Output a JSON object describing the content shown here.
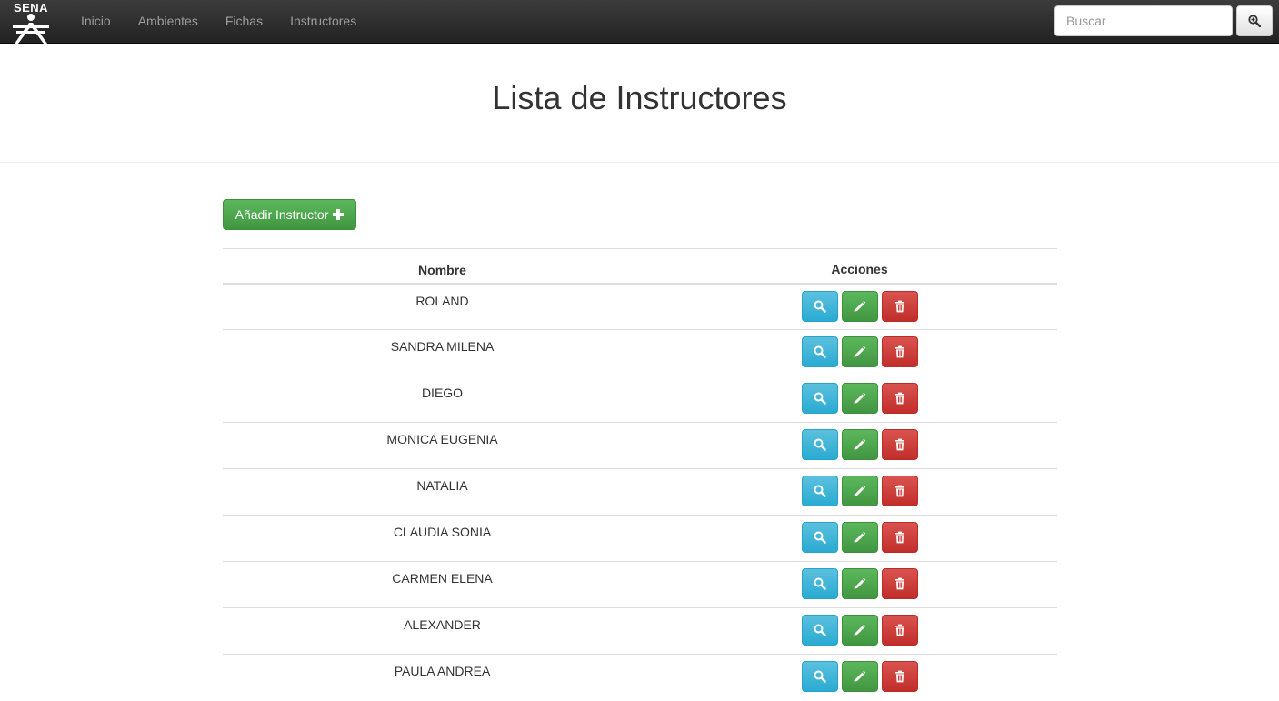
{
  "brand": {
    "logo_text": "SENA"
  },
  "nav": {
    "items": [
      {
        "label": "Inicio"
      },
      {
        "label": "Ambientes"
      },
      {
        "label": "Fichas"
      },
      {
        "label": "Instructores"
      }
    ]
  },
  "search": {
    "placeholder": "Buscar",
    "icon": "zoom-in-icon"
  },
  "page": {
    "title": "Lista de Instructores"
  },
  "toolbar": {
    "add_label": "Añadir Instructor",
    "add_icon": "plus-icon"
  },
  "table": {
    "columns": [
      "Nombre",
      "Acciones"
    ],
    "rows": [
      {
        "name": "ROLAND"
      },
      {
        "name": "SANDRA MILENA"
      },
      {
        "name": "DIEGO"
      },
      {
        "name": "MONICA EUGENIA"
      },
      {
        "name": "NATALIA"
      },
      {
        "name": "CLAUDIA SONIA"
      },
      {
        "name": "CARMEN ELENA"
      },
      {
        "name": "ALEXANDER"
      },
      {
        "name": "PAULA ANDREA"
      }
    ],
    "row_actions": [
      {
        "name": "view",
        "icon": "search-icon",
        "color": "#5bc0de"
      },
      {
        "name": "edit",
        "icon": "pencil-icon",
        "color": "#5cb85c"
      },
      {
        "name": "delete",
        "icon": "trash-icon",
        "color": "#d9534f"
      }
    ]
  },
  "colors": {
    "navbar": "#222222",
    "success": "#5cb85c",
    "info": "#5bc0de",
    "danger": "#d9534f"
  }
}
